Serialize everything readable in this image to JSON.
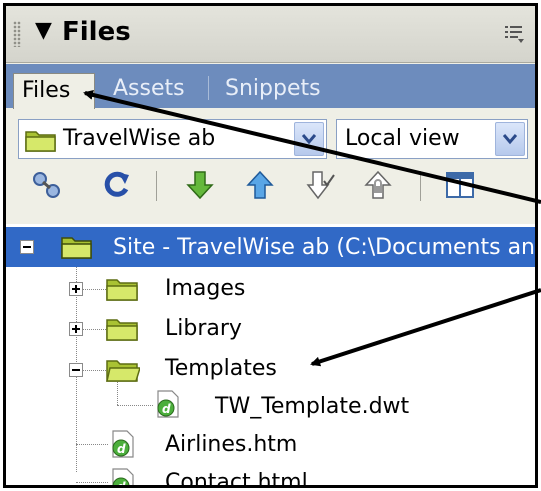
{
  "panel": {
    "title": "Files",
    "collapse_glyph": "▼"
  },
  "tabs": [
    {
      "label": "Files",
      "active": true
    },
    {
      "label": "Assets",
      "active": false
    },
    {
      "label": "Snippets",
      "active": false
    }
  ],
  "site_select": {
    "value": "TravelWise ab",
    "icon": "folder-icon"
  },
  "view_select": {
    "value": "Local view"
  },
  "toolbar": {
    "icons": [
      "connect-icon",
      "refresh-icon",
      "get-files-icon",
      "put-files-icon",
      "check-out-icon",
      "check-in-icon",
      "expand-icon"
    ]
  },
  "tree": {
    "root": {
      "label": "Site - TravelWise ab (C:\\Documents an",
      "expanded": true
    },
    "items": [
      {
        "label": "Images",
        "type": "folder",
        "expander": "plus"
      },
      {
        "label": "Library",
        "type": "folder",
        "expander": "plus"
      },
      {
        "label": "Templates",
        "type": "folder",
        "expander": "minus"
      },
      {
        "label": "TW_Template.dwt",
        "type": "file"
      },
      {
        "label": "Airlines.htm",
        "type": "file"
      },
      {
        "label": "Contact.html",
        "type": "file"
      }
    ]
  },
  "colors": {
    "tab_bar": "#6d8cbd",
    "selection": "#3169c6",
    "folder": "#c8dc52",
    "panel_bg": "#efefe6"
  }
}
